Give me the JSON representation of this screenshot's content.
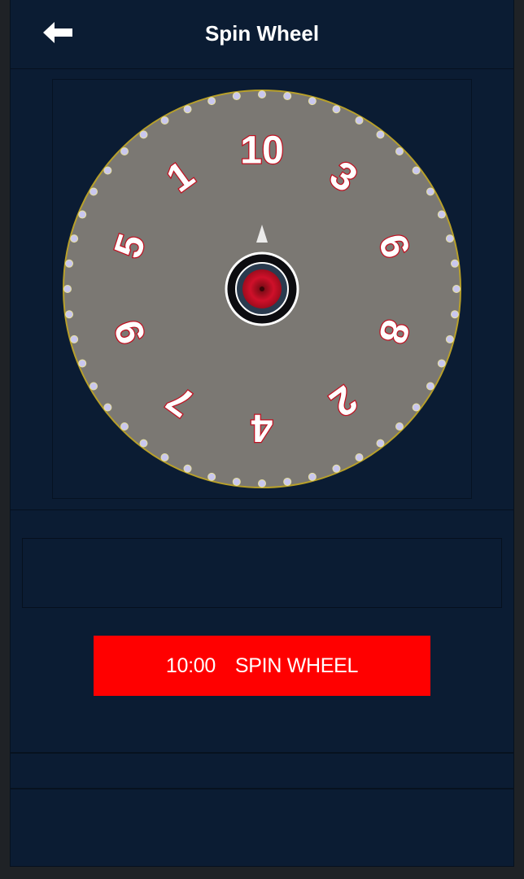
{
  "header": {
    "title": "Spin Wheel",
    "back_icon": "arrow-left-icon"
  },
  "wheel": {
    "segments": [
      "10",
      "3",
      "6",
      "8",
      "2",
      "4",
      "7",
      "9",
      "5",
      "1"
    ],
    "segment_colors": [
      "#ff1a2e",
      "#ff6a10",
      "#ffd000",
      "#2ad06a",
      "#8a2be2",
      "#ff1a2e"
    ],
    "rim_color": "#7b7873",
    "hub_color": "#c8102e",
    "pointer_icon": "pointer-triangle-icon"
  },
  "spin_button": {
    "timer": "10:00",
    "label": "SPIN WHEEL",
    "color": "#ff0000"
  }
}
